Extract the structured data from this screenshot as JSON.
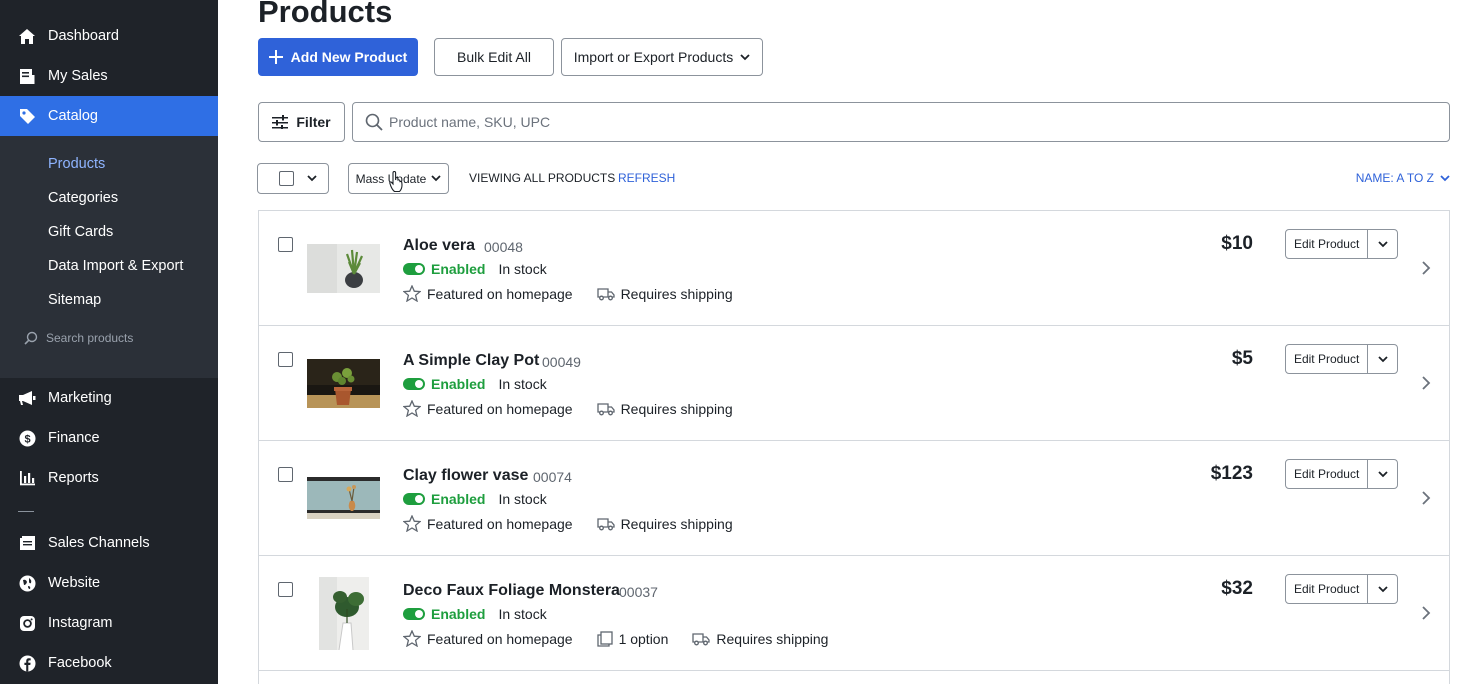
{
  "sidebar": {
    "top_items": [
      {
        "label": "Dashboard",
        "icon": "home-icon"
      },
      {
        "label": "My Sales",
        "icon": "receipt-icon"
      },
      {
        "label": "Catalog",
        "icon": "tag-icon"
      }
    ],
    "catalog_sub": [
      "Products",
      "Categories",
      "Gift Cards",
      "Data Import & Export",
      "Sitemap"
    ],
    "search_placeholder": "Search products",
    "mid_items": [
      {
        "label": "Marketing",
        "icon": "megaphone-icon"
      },
      {
        "label": "Finance",
        "icon": "dollar-icon"
      },
      {
        "label": "Reports",
        "icon": "bar-chart-icon"
      }
    ],
    "channel_items": [
      {
        "label": "Sales Channels",
        "icon": "storefront-icon"
      },
      {
        "label": "Website",
        "icon": "globe-icon"
      },
      {
        "label": "Instagram",
        "icon": "instagram-icon"
      },
      {
        "label": "Facebook",
        "icon": "facebook-icon"
      }
    ]
  },
  "page": {
    "title": "Products",
    "add_button": "Add New Product",
    "bulk_button": "Bulk Edit All",
    "import_button": "Import or Export Products",
    "filter_button": "Filter",
    "search_placeholder": "Product name, SKU, UPC",
    "mass_update": "Mass Update",
    "viewing": "VIEWING ALL PRODUCTS",
    "refresh": "REFRESH",
    "sort": "NAME: A TO Z"
  },
  "colors": {
    "sidebar_bg": "#1f2329",
    "accent": "#2f62d9",
    "enabled_green": "#1e9e3e"
  },
  "products": [
    {
      "name": "Aloe vera",
      "sku": "00048",
      "status": "Enabled",
      "stock": "In stock",
      "featured": "Featured on homepage",
      "shipping": "Requires shipping",
      "price": "$10",
      "edit": "Edit Product"
    },
    {
      "name": "A Simple Clay Pot",
      "sku": "00049",
      "status": "Enabled",
      "stock": "In stock",
      "featured": "Featured on homepage",
      "shipping": "Requires shipping",
      "price": "$5",
      "edit": "Edit Product"
    },
    {
      "name": "Clay flower vase",
      "sku": "00074",
      "status": "Enabled",
      "stock": "In stock",
      "featured": "Featured on homepage",
      "shipping": "Requires shipping",
      "price": "$123",
      "edit": "Edit Product"
    },
    {
      "name": "Deco Faux Foliage Monstera",
      "sku": "00037",
      "status": "Enabled",
      "stock": "In stock",
      "featured": "Featured on homepage",
      "option": "1 option",
      "shipping": "Requires shipping",
      "price": "$32",
      "edit": "Edit Product"
    }
  ]
}
